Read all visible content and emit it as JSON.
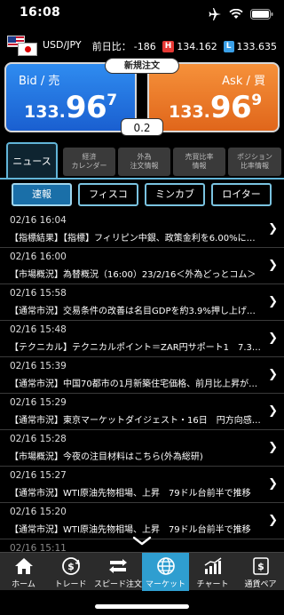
{
  "status_bar": {
    "time": "16:08"
  },
  "pair": {
    "name": "USD/JPY",
    "change_label": "前日比：",
    "change_value": "-186",
    "high_badge": "H",
    "high_value": "134.162",
    "low_badge": "L",
    "low_value": "133.635"
  },
  "quotes": {
    "bid": {
      "label": "Bid / 売",
      "price_prefix": "133.",
      "price_main": "96",
      "price_pip": "7"
    },
    "ask": {
      "label": "Ask / 買",
      "price_prefix": "133.",
      "price_main": "96",
      "price_pip": "9"
    },
    "new_order_label": "新規注文",
    "spread": "0.2"
  },
  "category_tabs": [
    {
      "label": "ニュース",
      "active": true
    },
    {
      "label": "経済\nカレンダー",
      "active": false
    },
    {
      "label": "外為\n注文情報",
      "active": false
    },
    {
      "label": "売買比率\n情報",
      "active": false
    },
    {
      "label": "ポジション\n比率情報",
      "active": false
    }
  ],
  "sources": [
    {
      "label": "速報",
      "active": true
    },
    {
      "label": "フィスコ",
      "active": false
    },
    {
      "label": "ミンカブ",
      "active": false
    },
    {
      "label": "ロイター",
      "active": false
    }
  ],
  "news": [
    {
      "datetime": "02/16 16:04",
      "title": "【指標結果】【指標】フィリピン中銀、政策金利を6.00%に…"
    },
    {
      "datetime": "02/16 16:00",
      "title": "【市場概況】為替概況（16:00）23/2/16＜外為どっとコム＞"
    },
    {
      "datetime": "02/16 15:58",
      "title": "【通常市況】交易条件の改善は名目GDPを約3.9%押し上げ…"
    },
    {
      "datetime": "02/16 15:48",
      "title": "【テクニカル】テクニカルポイント＝ZAR円サポート1　7.3…"
    },
    {
      "datetime": "02/16 15:39",
      "title": "【通常市況】中国70都市の1月新築住宅価格、前月比上昇が…"
    },
    {
      "datetime": "02/16 15:29",
      "title": "【通常市況】東京マーケットダイジェスト・16日　円方向感…"
    },
    {
      "datetime": "02/16 15:28",
      "title": "【市場概況】今夜の注目材料はこちら(外為総研)"
    },
    {
      "datetime": "02/16 15:27",
      "title": "【通常市況】WTI原油先物相場、上昇　79ドル台前半で推移"
    },
    {
      "datetime": "02/16 15:20",
      "title": "【通常市況】WTI原油先物相場、上昇　79ドル台前半で推移"
    },
    {
      "datetime": "02/16 15:11",
      "title": ""
    }
  ],
  "tab_bar": [
    {
      "label": "ホーム",
      "icon": "home-icon",
      "active": false
    },
    {
      "label": "トレード",
      "icon": "trade-icon",
      "active": false
    },
    {
      "label": "スピード注文",
      "icon": "speed-order-icon",
      "active": false
    },
    {
      "label": "マーケット",
      "icon": "globe-icon",
      "active": true
    },
    {
      "label": "チャート",
      "icon": "chart-icon",
      "active": false
    },
    {
      "label": "通貨ペア",
      "icon": "currency-pair-icon",
      "active": false
    }
  ],
  "colors": {
    "bid": "#1a5fd0",
    "ask": "#e0661b",
    "accent": "#2f9ed0",
    "high": "#e53935",
    "low": "#3aa0e8"
  }
}
